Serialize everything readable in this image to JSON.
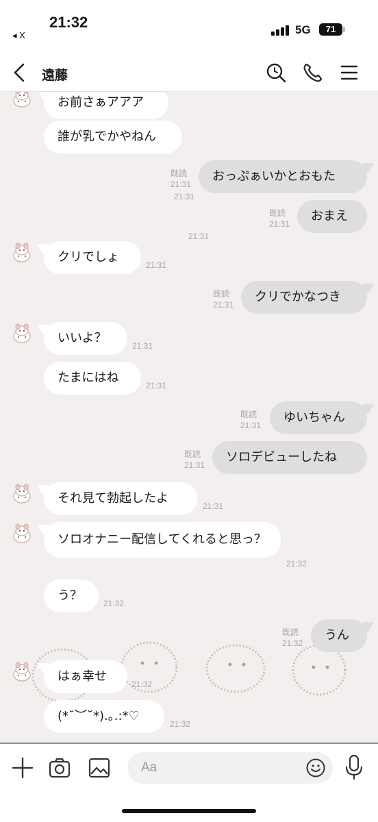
{
  "status": {
    "time": "21:32",
    "back_app": "◂ X",
    "network": "5G",
    "battery": "71"
  },
  "header": {
    "title": "遠藤"
  },
  "messages": [
    {
      "id": "m0",
      "side": "in",
      "text": "お前さぁアアア",
      "time": "21:31",
      "read": ""
    },
    {
      "id": "m1",
      "side": "in",
      "text": "誰が乳でかやねん",
      "time": "21:31",
      "read": ""
    },
    {
      "id": "m2",
      "side": "out",
      "text": "おっぷぁいかとおもた",
      "time": "21:31",
      "read": "既読"
    },
    {
      "id": "m3",
      "side": "out",
      "text": "おまえ",
      "time": "21:31",
      "read": "既読"
    },
    {
      "id": "m4",
      "side": "in",
      "text": "クリでしょ",
      "time": "21:31",
      "read": ""
    },
    {
      "id": "m5",
      "side": "out",
      "text": "クリでかなつき",
      "time": "21:31",
      "read": "既読"
    },
    {
      "id": "m6",
      "side": "in",
      "text": "いいよ？",
      "time": "21:31",
      "read": ""
    },
    {
      "id": "m7",
      "side": "in",
      "text": "たまにはね",
      "time": "21:31",
      "read": ""
    },
    {
      "id": "m8",
      "side": "out",
      "text": "ゆいちゃん",
      "time": "21:31",
      "read": "既読"
    },
    {
      "id": "m9",
      "side": "out",
      "text": "ソロデビューしたね",
      "time": "21:31",
      "read": "既読"
    },
    {
      "id": "m10",
      "side": "in",
      "text": "それ見て勃起したよ",
      "time": "21:31",
      "read": ""
    },
    {
      "id": "m11",
      "side": "in",
      "text": "ソロオナニー配信してくれると思っ？",
      "time": "21:32",
      "read": ""
    },
    {
      "id": "m12",
      "side": "in",
      "text": "う？",
      "time": "21:32",
      "read": ""
    },
    {
      "id": "m13",
      "side": "out",
      "text": "うん",
      "time": "21:32",
      "read": "既読"
    },
    {
      "id": "m14",
      "side": "in",
      "text": "はぁ幸せ",
      "time": "21:32",
      "read": ""
    },
    {
      "id": "m15",
      "side": "in",
      "text": "(*˘︶˘*).｡.:*♡",
      "time": "21:32",
      "read": ""
    }
  ],
  "input": {
    "placeholder": "Aa"
  },
  "icons": {
    "header": [
      "back-icon",
      "search-icon",
      "phone-icon",
      "menu-icon"
    ],
    "inputbar": [
      "plus-icon",
      "camera-icon",
      "image-icon",
      "emoji-icon",
      "mic-icon"
    ]
  }
}
